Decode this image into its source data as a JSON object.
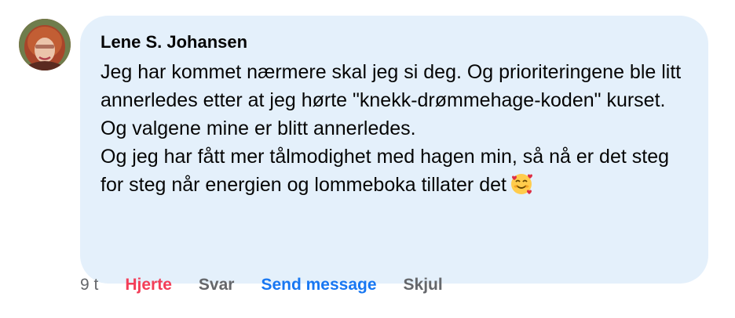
{
  "comment": {
    "author": "Lene S. Johansen",
    "paragraphs": [
      "Jeg har kommet nærmere skal jeg si deg. Og prioriteringene ble litt annerledes etter at jeg hørte \"knekk-drømmehage-koden\" kurset. Og valgene mine er blitt annerledes.",
      "Og jeg har fått mer tålmodighet med hagen min, så nå er det steg for steg når energien og lommeboka tillater det"
    ],
    "emoji": "smiling-face-with-hearts-icon"
  },
  "actions": {
    "time": "9 t",
    "heart": "Hjerte",
    "reply": "Svar",
    "send_message": "Send message",
    "hide": "Skjul"
  },
  "colors": {
    "bubble": "#e4f0fb",
    "heart": "#f33e58",
    "link": "#1877f2",
    "muted": "#65676b"
  }
}
